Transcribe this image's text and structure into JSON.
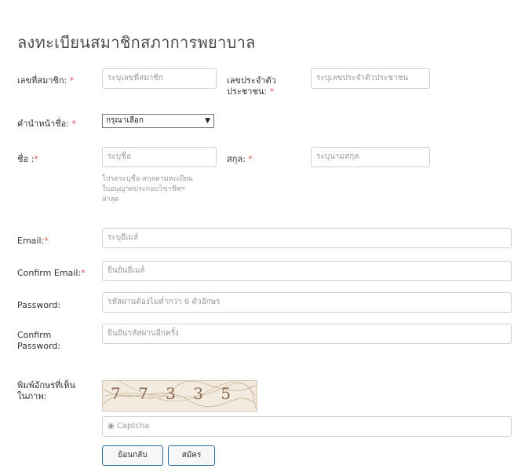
{
  "form": {
    "title": "ลงทะเบียนสมาชิกสภาการพยาบาล",
    "member_no": {
      "label": "เลขที่สมาชิก:",
      "req": "*",
      "placeholder": "ระบุเลขที่สมาชิก"
    },
    "id_no": {
      "label1": "เลขประจำตัว",
      "label2": "ประชาชน:",
      "req": "*",
      "placeholder": "ระบุเลขประจำตัวประชาชน"
    },
    "prefix": {
      "label": "คำนำหน้าชื่อ:",
      "req": "*",
      "selected": "กรุณาเลือก",
      "caret": "▼"
    },
    "first_name": {
      "label": "ชื่อ :",
      "req": "*",
      "placeholder": "ระบุชื่อ",
      "help1": "โปรดระบุชื่อ-สกุลตามทะเบียน",
      "help2": "ใบอนุญาตประกอบวิชาชีพฯ",
      "help3": "ล่าสุด"
    },
    "last_name": {
      "label": "สกุล:",
      "req": "*",
      "placeholder": "ระบุนามสกุล"
    },
    "email": {
      "label": "Email:",
      "req": "*",
      "placeholder": "ระบุอีเมล์"
    },
    "confirm_email": {
      "label": "Confirm Email:",
      "req": "*",
      "placeholder": "ยืนยันอีเมล์"
    },
    "password": {
      "label": "Password:",
      "placeholder": "รหัสผ่านต้องไม่ต่ำกว่า 6 ตัวอักษร"
    },
    "confirm_password": {
      "label1": "Confirm",
      "label2": "Password:",
      "placeholder": "ยืนยันรหัสผ่านอีกครั้ง"
    },
    "captcha": {
      "label1": "พิมพ์อักษรที่เห็น",
      "label2": "ในภาพ:",
      "image_text": "7 7 3 3 5",
      "input_icon": "◉",
      "placeholder": "Captcha"
    },
    "buttons": {
      "back": "ย้อนกลับ",
      "register": "สมัคร"
    }
  },
  "colors": {
    "required": "#d9534f",
    "button_border": "#2e6da4"
  }
}
